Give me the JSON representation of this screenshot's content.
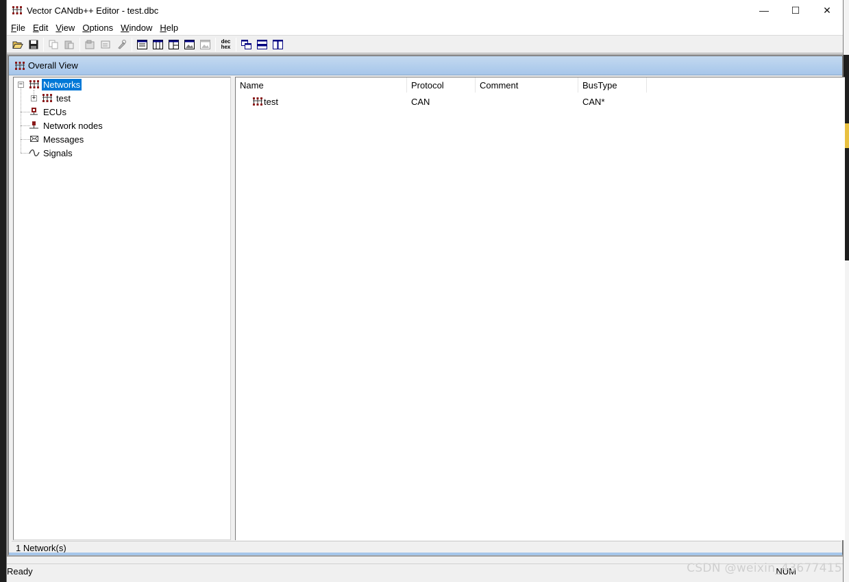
{
  "window": {
    "title": "Vector CANdb++ Editor - test.dbc",
    "controls": {
      "minimize": "—",
      "maximize": "☐",
      "close": "✕"
    }
  },
  "menu": [
    {
      "label": "File",
      "accel": "F",
      "rest": "ile"
    },
    {
      "label": "Edit",
      "accel": "E",
      "rest": "dit"
    },
    {
      "label": "View",
      "accel": "V",
      "rest": "iew"
    },
    {
      "label": "Options",
      "accel": "O",
      "rest": "ptions"
    },
    {
      "label": "Window",
      "accel": "W",
      "rest": "indow"
    },
    {
      "label": "Help",
      "accel": "H",
      "rest": "elp"
    }
  ],
  "toolbar": {
    "icons": [
      "open-folder-icon",
      "save-icon",
      "copy-icon",
      "paste-icon",
      "properties-icon",
      "edit-icon",
      "tools-icon",
      "view-list-icon",
      "view-columns-icon",
      "view-details-icon",
      "view-image-icon",
      "view-image2-icon",
      "dec-hex-icon",
      "cascade-windows-icon",
      "tile-horizontal-icon",
      "tile-vertical-icon"
    ],
    "dechex_top": "dec",
    "dechex_bottom": "hex"
  },
  "child_window": {
    "title": "Overall View"
  },
  "tree": {
    "items": [
      {
        "label": "Networks",
        "icon": "network-icon",
        "selected": true,
        "expanded": true
      },
      {
        "label": "test",
        "icon": "network-icon",
        "expandable": true
      },
      {
        "label": "ECUs",
        "icon": "ecu-icon"
      },
      {
        "label": "Network nodes",
        "icon": "node-icon"
      },
      {
        "label": "Messages",
        "icon": "envelope-icon"
      },
      {
        "label": "Signals",
        "icon": "signal-wave-icon"
      }
    ],
    "expander_plus": "+",
    "expander_minus": "−"
  },
  "list": {
    "columns": [
      "Name",
      "Protocol",
      "Comment",
      "BusType"
    ],
    "rows": [
      {
        "name": "test",
        "protocol": "CAN",
        "comment": "",
        "bustype": "CAN*"
      }
    ]
  },
  "child_status": "1 Network(s)",
  "statusbar": {
    "ready": "Ready",
    "num": "NUM"
  },
  "watermark": "CSDN @weixin_43677415",
  "colors": {
    "selection": "#0078d7",
    "caption_gradient_top": "#c3d9f0",
    "caption_gradient_bottom": "#a6c6ea",
    "network_icon": "#8b1a1a"
  }
}
